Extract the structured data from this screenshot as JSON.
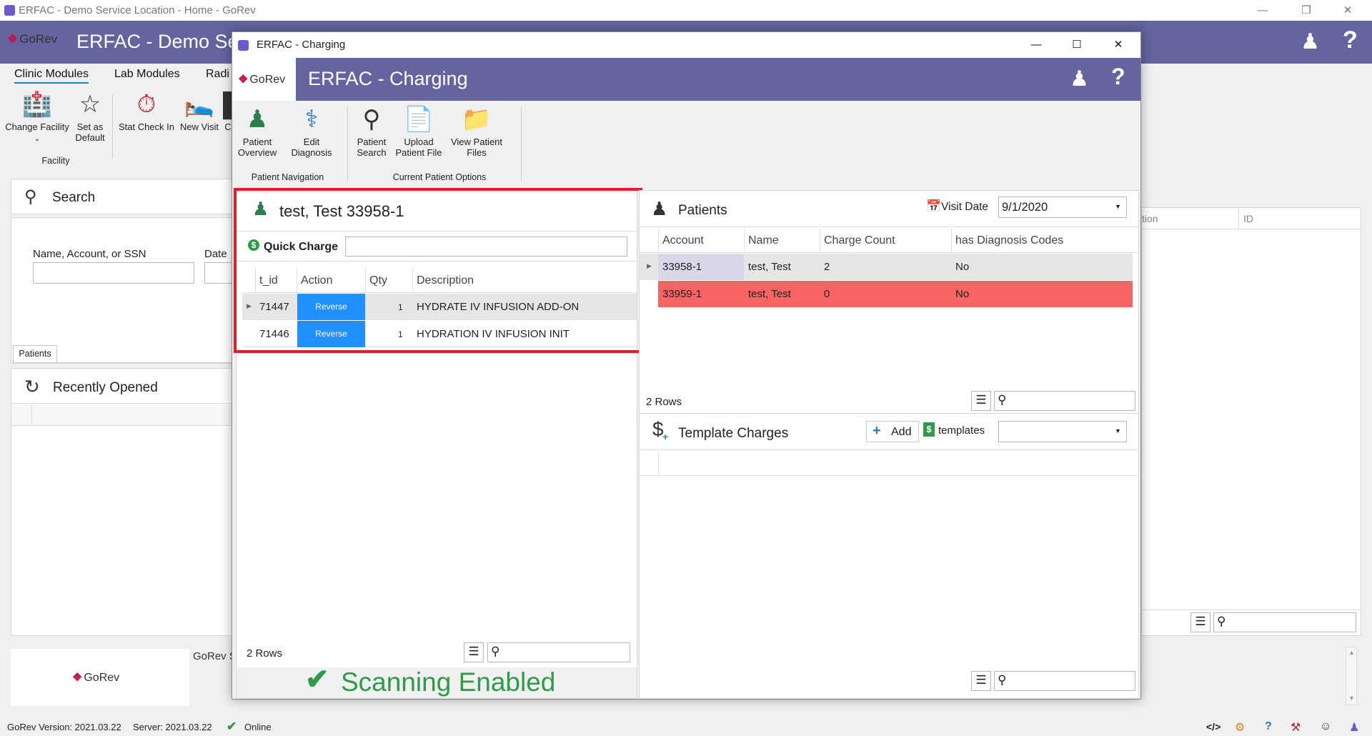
{
  "main_window": {
    "title": "ERFAC - Demo Service Location - Home - GoRev",
    "banner_title": "ERFAC - Demo Ser",
    "logo_text": "GoRev",
    "ribbon_tabs": [
      "Clinic Modules",
      "Lab Modules",
      "Radi"
    ],
    "ribbon_buttons": {
      "change_facility": "Change Facility",
      "set_as_default": "Set as Default",
      "stat_check_in": "Stat Check In",
      "new_visit": "New Visit",
      "cut": "C"
    },
    "facility_group_label": "Facility",
    "search": {
      "title": "Search",
      "name_label": "Name, Account, or SSN",
      "date_label": "Date o"
    },
    "patients_tab": "Patients",
    "recently_opened": "Recently Opened",
    "right_grid_headers": [
      "tion",
      "ID"
    ],
    "gorev_label": "GoRev S",
    "footer_logo": "GoRev"
  },
  "status_bar": {
    "version": "GoRev Version: 2021.03.22",
    "server": "Server: 2021.03.22",
    "online": "Online"
  },
  "dialog": {
    "title": "ERFAC - Charging",
    "banner_title": "ERFAC - Charging",
    "logo_text": "GoRev",
    "ribbon": {
      "patient_overview": "Patient Overview",
      "edit_diagnosis": "Edit Diagnosis",
      "patient_search": "Patient Search",
      "upload_patient_file": "Upload Patient File",
      "view_patient_files": "View Patient Files",
      "group_patient_navigation": "Patient Navigation",
      "group_current_patient_options": "Current Patient Options"
    },
    "patient_header": "test, Test 33958-1",
    "quick_charge_label": "Quick Charge",
    "quick_charge_value": "",
    "charges_grid": {
      "headers": [
        "t_id",
        "Action",
        "Qty",
        "Description"
      ],
      "rows": [
        {
          "t_id": "71447",
          "action": "Reverse",
          "qty": "1",
          "description": "HYDRATE IV INFUSION ADD-ON"
        },
        {
          "t_id": "71446",
          "action": "Reverse",
          "qty": "1",
          "description": "HYDRATION IV INFUSION INIT"
        }
      ],
      "row_count": "2 Rows"
    },
    "scanning_status": "Scanning Enabled",
    "patients_panel": {
      "title": "Patients",
      "visit_date_label": "Visit Date",
      "visit_date_value": "9/1/2020",
      "headers": [
        "Account",
        "Name",
        "Charge Count",
        "has Diagnosis Codes"
      ],
      "rows": [
        {
          "account": "33958-1",
          "name": "test, Test",
          "charge_count": "2",
          "has_dx": "No"
        },
        {
          "account": "33959-1",
          "name": "test, Test",
          "charge_count": "0",
          "has_dx": "No"
        }
      ],
      "row_count": "2 Rows"
    },
    "template_charges": {
      "title": "Template Charges",
      "add_label": "Add",
      "templates_label": "templates",
      "templates_value": ""
    }
  },
  "colors": {
    "banner": "#64649e",
    "highlight_red": "#dd1f26",
    "row_red": "#f76464",
    "reverse_blue": "#1e90ff",
    "scanning_green": "#2e9a4a"
  }
}
